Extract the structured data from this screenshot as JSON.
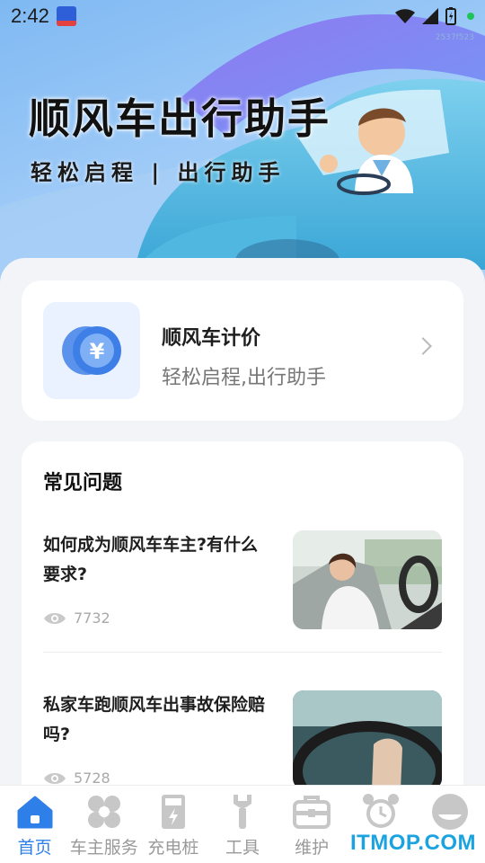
{
  "status_bar": {
    "time": "2:42",
    "mini_label": "2537f523"
  },
  "hero": {
    "title": "顺风车出行助手",
    "subtitle": "轻松启程 | 出行助手"
  },
  "price_card": {
    "icon": "yuan-coin-icon",
    "title": "顺风车计价",
    "description": "轻松启程,出行助手"
  },
  "faq": {
    "heading": "常见问题",
    "items": [
      {
        "question": "如何成为顺风车车主?有什么要求?",
        "views": "7732",
        "image": "woman-driving-photo"
      },
      {
        "question": "私家车跑顺风车出事故保险赔吗?",
        "views": "5728",
        "image": "steering-wheel-photo"
      }
    ]
  },
  "bottom_nav": {
    "items": [
      {
        "label": "首页",
        "icon": "home-icon",
        "active": true
      },
      {
        "label": "车主服务",
        "icon": "flower-icon",
        "active": false
      },
      {
        "label": "充电桩",
        "icon": "charging-pile-icon",
        "active": false
      },
      {
        "label": "工具",
        "icon": "wrench-icon",
        "active": false
      },
      {
        "label": "维护",
        "icon": "toolbox-icon",
        "active": false
      },
      {
        "label": "",
        "icon": "alarm-clock-icon",
        "active": false
      },
      {
        "label": "",
        "icon": "profile-icon",
        "active": false
      }
    ]
  },
  "watermark": "ITMOP.COM",
  "colors": {
    "accent": "#2f7fe8",
    "hero_bg": "#9cc9f7",
    "coin": "#3d7fe6"
  }
}
